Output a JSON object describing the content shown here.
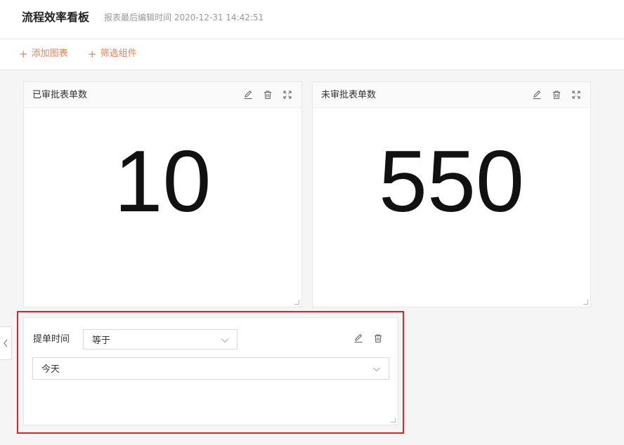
{
  "header": {
    "title": "流程效率看板",
    "last_edit": "报表最后编辑时间 2020-12-31 14:42:51"
  },
  "toolbar": {
    "add_chart": "添加图表",
    "filter_component": "筛选组件",
    "plus": "+"
  },
  "cards": [
    {
      "title": "已审批表单数",
      "value": "10"
    },
    {
      "title": "未审批表单数",
      "value": "550"
    }
  ],
  "filter": {
    "label": "提单时间",
    "operator": "等于",
    "value": "今天"
  },
  "colors": {
    "accent": "#e5835a",
    "highlight": "#d9262c"
  }
}
